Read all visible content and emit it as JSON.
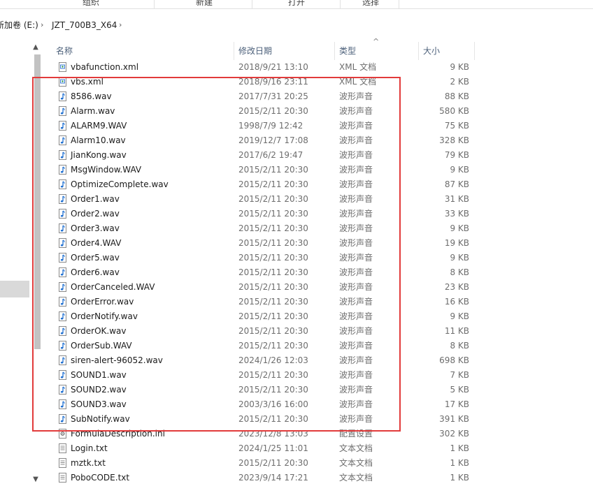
{
  "ribbon": {
    "groups": [
      "组织",
      "新建",
      "打开",
      "选择"
    ]
  },
  "address": {
    "drive": "新加卷 (E:)",
    "folder": "JZT_700B3_X64",
    "separator": "›"
  },
  "columns": {
    "name": "名称",
    "date": "修改日期",
    "type": "类型",
    "size": "大小"
  },
  "icons": {
    "scroll_up": "▲",
    "scroll_down": "▼",
    "sort": "^"
  },
  "files": [
    {
      "name": "vbafunction.xml",
      "date": "2018/9/21 13:10",
      "type": "XML 文档",
      "size": "9 KB",
      "kind": "xml"
    },
    {
      "name": "vbs.xml",
      "date": "2018/9/16 23:11",
      "type": "XML 文档",
      "size": "2 KB",
      "kind": "xml"
    },
    {
      "name": "8586.wav",
      "date": "2017/7/31 20:25",
      "type": "波形声音",
      "size": "88 KB",
      "kind": "wav"
    },
    {
      "name": "Alarm.wav",
      "date": "2015/2/11 20:30",
      "type": "波形声音",
      "size": "580 KB",
      "kind": "wav"
    },
    {
      "name": "ALARM9.WAV",
      "date": "1998/7/9 12:42",
      "type": "波形声音",
      "size": "75 KB",
      "kind": "wav"
    },
    {
      "name": "Alarm10.wav",
      "date": "2019/12/7 17:08",
      "type": "波形声音",
      "size": "328 KB",
      "kind": "wav"
    },
    {
      "name": "JianKong.wav",
      "date": "2017/6/2 19:47",
      "type": "波形声音",
      "size": "79 KB",
      "kind": "wav"
    },
    {
      "name": "MsgWindow.WAV",
      "date": "2015/2/11 20:30",
      "type": "波形声音",
      "size": "9 KB",
      "kind": "wav"
    },
    {
      "name": "OptimizeComplete.wav",
      "date": "2015/2/11 20:30",
      "type": "波形声音",
      "size": "87 KB",
      "kind": "wav"
    },
    {
      "name": "Order1.wav",
      "date": "2015/2/11 20:30",
      "type": "波形声音",
      "size": "31 KB",
      "kind": "wav"
    },
    {
      "name": "Order2.wav",
      "date": "2015/2/11 20:30",
      "type": "波形声音",
      "size": "33 KB",
      "kind": "wav"
    },
    {
      "name": "Order3.wav",
      "date": "2015/2/11 20:30",
      "type": "波形声音",
      "size": "9 KB",
      "kind": "wav"
    },
    {
      "name": "Order4.WAV",
      "date": "2015/2/11 20:30",
      "type": "波形声音",
      "size": "19 KB",
      "kind": "wav"
    },
    {
      "name": "Order5.wav",
      "date": "2015/2/11 20:30",
      "type": "波形声音",
      "size": "9 KB",
      "kind": "wav"
    },
    {
      "name": "Order6.wav",
      "date": "2015/2/11 20:30",
      "type": "波形声音",
      "size": "8 KB",
      "kind": "wav"
    },
    {
      "name": "OrderCanceled.WAV",
      "date": "2015/2/11 20:30",
      "type": "波形声音",
      "size": "23 KB",
      "kind": "wav"
    },
    {
      "name": "OrderError.wav",
      "date": "2015/2/11 20:30",
      "type": "波形声音",
      "size": "16 KB",
      "kind": "wav"
    },
    {
      "name": "OrderNotify.wav",
      "date": "2015/2/11 20:30",
      "type": "波形声音",
      "size": "9 KB",
      "kind": "wav"
    },
    {
      "name": "OrderOK.wav",
      "date": "2015/2/11 20:30",
      "type": "波形声音",
      "size": "11 KB",
      "kind": "wav"
    },
    {
      "name": "OrderSub.WAV",
      "date": "2015/2/11 20:30",
      "type": "波形声音",
      "size": "8 KB",
      "kind": "wav"
    },
    {
      "name": "siren-alert-96052.wav",
      "date": "2024/1/26 12:03",
      "type": "波形声音",
      "size": "698 KB",
      "kind": "wav"
    },
    {
      "name": "SOUND1.wav",
      "date": "2015/2/11 20:30",
      "type": "波形声音",
      "size": "7 KB",
      "kind": "wav"
    },
    {
      "name": "SOUND2.wav",
      "date": "2015/2/11 20:30",
      "type": "波形声音",
      "size": "5 KB",
      "kind": "wav"
    },
    {
      "name": "SOUND3.wav",
      "date": "2003/3/16 16:00",
      "type": "波形声音",
      "size": "17 KB",
      "kind": "wav"
    },
    {
      "name": "SubNotify.wav",
      "date": "2015/2/11 20:30",
      "type": "波形声音",
      "size": "391 KB",
      "kind": "wav"
    },
    {
      "name": "FormulaDescription.ini",
      "date": "2023/12/8 13:03",
      "type": "配置设置",
      "size": "302 KB",
      "kind": "ini"
    },
    {
      "name": "Login.txt",
      "date": "2024/1/25 11:01",
      "type": "文本文档",
      "size": "1 KB",
      "kind": "txt"
    },
    {
      "name": "mztk.txt",
      "date": "2015/2/11 20:30",
      "type": "文本文档",
      "size": "1 KB",
      "kind": "txt"
    },
    {
      "name": "PoboCODE.txt",
      "date": "2023/9/14 17:21",
      "type": "文本文档",
      "size": "1 KB",
      "kind": "txt"
    }
  ],
  "highlight_color": "#e23b3b",
  "wav_icon_color": "#1f6fd1"
}
